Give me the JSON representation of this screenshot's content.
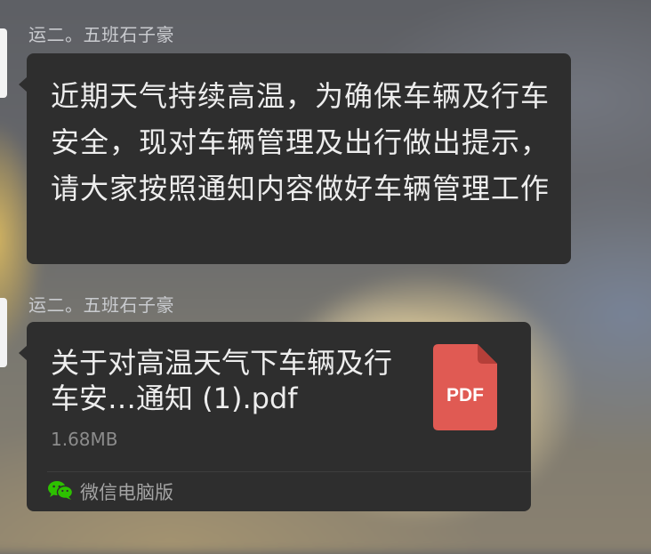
{
  "messages": [
    {
      "sender": "运二。五班石子豪",
      "text": "近期天气持续高温，为确保车辆及行车安全，现对车辆管理及出行做出提示，请大家按照通知内容做好车辆管理工作"
    },
    {
      "sender": "运二。五班石子豪",
      "file": {
        "name": "关于对高温天气下车辆及行车安…通知 (1).pdf",
        "size": "1.68MB",
        "type_label": "PDF",
        "icon": "pdf-file-icon",
        "color": "#e05a53",
        "source_icon": "wechat-icon",
        "source": "微信电脑版"
      }
    }
  ],
  "colors": {
    "bubble": "#2e2e2e",
    "text": "#ededed",
    "sender": "#c9cbcf",
    "wechat_green": "#2dc100"
  }
}
